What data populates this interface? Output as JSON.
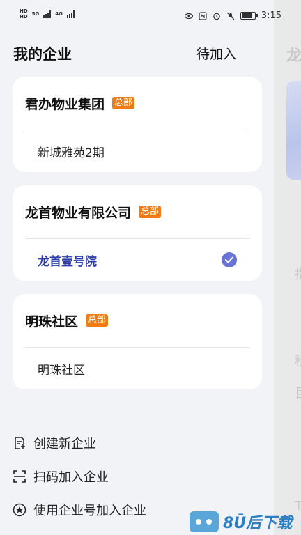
{
  "status_bar": {
    "hd_labels": [
      "HD",
      "HD"
    ],
    "network_labels": [
      "5G",
      "4G"
    ],
    "time": "3:15"
  },
  "background": {
    "title": "龙",
    "text1": "指",
    "text2": "移",
    "text3": "目",
    "text4": "T"
  },
  "drawer": {
    "title": "我的企业",
    "pending_label": "待加入",
    "companies": [
      {
        "name": "君办物业集团",
        "badge": "总部",
        "community": "新城雅苑2期",
        "selected": false
      },
      {
        "name": "龙首物业有限公司",
        "badge": "总部",
        "community": "龙首壹号院",
        "selected": true
      },
      {
        "name": "明珠社区",
        "badge": "总部",
        "community": "明珠社区",
        "selected": false
      }
    ],
    "menu": [
      {
        "label": "创建新企业",
        "icon": "create-document-icon"
      },
      {
        "label": "扫码加入企业",
        "icon": "scan-icon"
      },
      {
        "label": "使用企业号加入企业",
        "icon": "star-circle-icon"
      }
    ]
  },
  "watermark": {
    "text": "8Ū后下载"
  },
  "colors": {
    "accent": "#2d3da8",
    "badge": "#f07a14",
    "check": "#6a73d6"
  }
}
